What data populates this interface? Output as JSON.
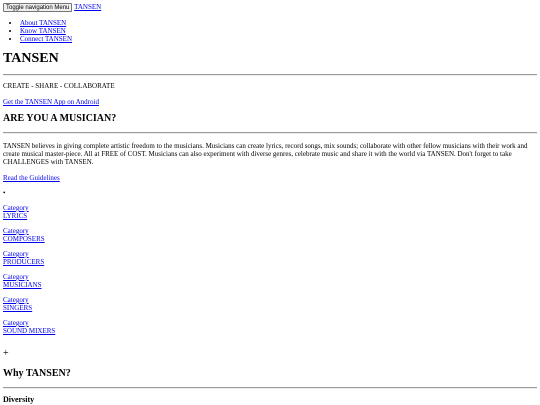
{
  "navbar": {
    "toggle_label": "Toggle navigation Menu",
    "brand": "TANSEN",
    "items": [
      {
        "label": "About TANSEN"
      },
      {
        "label": "Know TANSEN"
      },
      {
        "label": "Connect TANSEN"
      }
    ]
  },
  "hero": {
    "title": "TANSEN",
    "tagline": "CREATE - SHARE - COLLABORATE",
    "app_link": "Get the TANSEN App on Android"
  },
  "musician": {
    "heading": "ARE YOU A MUSICIAN?",
    "intro": "TANSEN believes in giving complete artistic freedom to the musicians. Musicians can create lyrics, record songs, mix sounds; collaborate with other fellow musicians with their work and create musical master-piece. All at FREE of COST. Musicians can also experiment with diverse genres, celebrate music and share it with the world via TANSEN. Don't forget to take CHALLENGES with TANSEN.",
    "guidelines_link": "Read the Guidelines",
    "bullet": "•"
  },
  "categories": [
    {
      "prefix": "Category",
      "name": "LYRICS"
    },
    {
      "prefix": "Category",
      "name": "COMPOSERS"
    },
    {
      "prefix": "Category",
      "name": "PRODUCERS"
    },
    {
      "prefix": "Category",
      "name": "MUSICIANS"
    },
    {
      "prefix": "Category",
      "name": "SINGERS"
    },
    {
      "prefix": "Category",
      "name": "SOUND MIXERS"
    }
  ],
  "why": {
    "plus": "+",
    "heading": "Why TANSEN?",
    "first_item": "Diversity"
  }
}
